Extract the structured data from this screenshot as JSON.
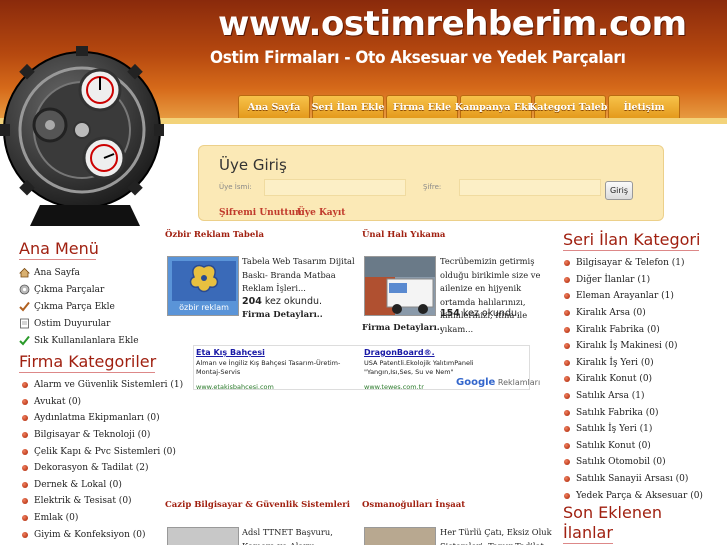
{
  "header": {
    "site_url": "www.ostimrehberim.com",
    "tagline": "Ostim Firmaları - Oto Aksesuar ve Yedek Parçaları",
    "nav": [
      "Ana Sayfa",
      "Seri İlan Ekle",
      "Firma Ekle",
      "Kampanya Ekle",
      "Kategori Talebi",
      "İletişim"
    ]
  },
  "login": {
    "title": "Üye Giriş",
    "username_label": "Üye İsmi:",
    "password_label": "Şifre:",
    "button": "Giriş",
    "forgot_link": "Şifremi Unuttum",
    "register_link": "Üye Kayıt"
  },
  "main_menu": {
    "heading": "Ana Menü",
    "items": [
      {
        "label": "Ana Sayfa",
        "icon": "home-icon"
      },
      {
        "label": "Çıkma Parçalar",
        "icon": "parts-icon"
      },
      {
        "label": "Çıkma Parça Ekle",
        "icon": "check-icon"
      },
      {
        "label": "Ostim Duyurular",
        "icon": "notepad-icon"
      },
      {
        "label": "Sık Kullanılanlara Ekle",
        "icon": "check-icon"
      }
    ]
  },
  "firm_categories": {
    "heading": "Firma Kategoriler",
    "items": [
      "Alarm ve Güvenlik Sistemleri (1)",
      "Avukat (0)",
      "Aydınlatma Ekipmanları (0)",
      "Bilgisayar & Teknoloji (0)",
      "Çelik Kapı & Pvc Sistemleri (0)",
      "Dekorasyon & Tadilat (2)",
      "Dernek & Lokal (0)",
      "Elektrik & Tesisat (0)",
      "Emlak (0)",
      "Giyim & Konfeksiyon (0)"
    ]
  },
  "ilan_categories": {
    "heading": "Seri İlan Kategori",
    "items": [
      "Bilgisayar & Telefon (1)",
      "Diğer İlanlar (1)",
      "Eleman Arayanlar (1)",
      "Kiralık Arsa (0)",
      "Kiralık Fabrika (0)",
      "Kiralık İş Makinesi (0)",
      "Kiralık İş Yeri (0)",
      "Kiralık Konut (0)",
      "Satılık Arsa (1)",
      "Satılık Fabrika (0)",
      "Satılık İş Yeri (1)",
      "Satılık Konut (0)",
      "Satılık Otomobil (0)",
      "Satılık Sanayii Arsası (0)",
      "Yedek Parça & Aksesuar (0)"
    ]
  },
  "son_eklenen": {
    "line1": "Son Eklenen",
    "line2": "İlanlar"
  },
  "firms": [
    {
      "title": "Özbir Reklam Tabela",
      "desc": "Tabela Web Tasarım Dijital Baskı- Branda Matbaa Reklam İşleri...",
      "count": "204",
      "count_suffix": " kez okundu.",
      "detail": "Firma Detayları.."
    },
    {
      "title": "Ünal Halı Yıkama",
      "desc": "Tecrübemizin getirmiş olduğu birikimle size ve ailenize en hijyenik ortamda halılarınızı, kilimlerinizi, itina ile yıkam...",
      "count": "154",
      "count_suffix": " kez okundu.",
      "detail": "Firma Detayları.."
    },
    {
      "title": "Cazip Bilgisayar & Güvenlik Sistemleri",
      "desc": "Adsl TTNET Başvuru, Kamera ve Alarm Sistemleri, Medyaya..."
    },
    {
      "title": "Osmanoğulları İnşaat",
      "desc": "Her Türlü Çatı, Eksiz Oluk Sistemleri, Tamır Tadilat..."
    }
  ],
  "logo_text": "özbir reklam",
  "ads": {
    "ad1_title": "Eta Kış Bahçesi",
    "ad1_text": "Alman ve İngiliz Kış Bahçesi Tasarım-Üretim-Montaj-Servis",
    "ad1_url": "www.etakisbahcesi.com",
    "ad2_title": "DragonBoard®.",
    "ad2_text": "USA Patentli.Ekolojik YalıtımPaneli \"Yangın,Isı,Ses, Su ve Nem\"",
    "ad2_url": "www.tewes.com.tr",
    "google_brand": "Google",
    "google_label": " Reklamları"
  }
}
